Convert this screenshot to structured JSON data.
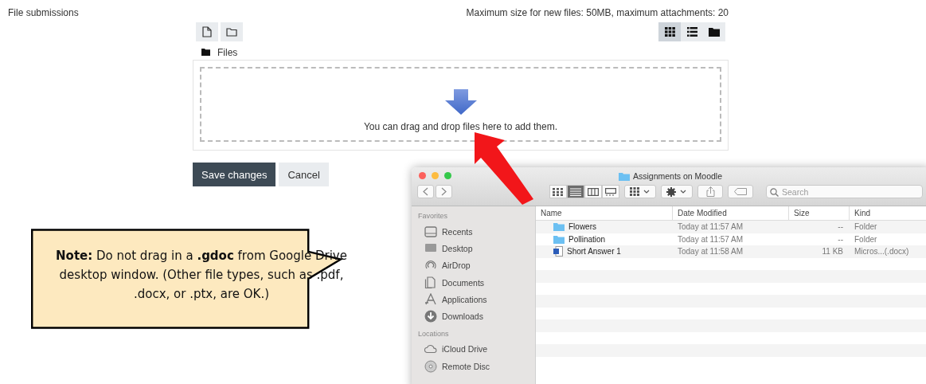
{
  "section_label": "File submissions",
  "limits": "Maximum size for new files: 50MB, maximum attachments: 20",
  "view_modes": [
    {
      "kind": "grid",
      "selected": true
    },
    {
      "kind": "list",
      "selected": false
    },
    {
      "kind": "tree",
      "selected": false
    }
  ],
  "breadcrumb": "Files",
  "dropzone_text": "You can drag and drop files here to add them.",
  "buttons": [
    {
      "label": "Save changes",
      "kind": "primary"
    },
    {
      "label": "Cancel",
      "kind": "secondary"
    }
  ],
  "callout": {
    "text": "**Note:** Do not drag in a **.gdoc** from Google Drive desktop window. (Other file types, such as .pdf, .docx, or .ptx, are OK.)"
  },
  "finder": {
    "title": "Assignments on Moodle",
    "view_modes": [
      {
        "kind": "icons",
        "selected": false
      },
      {
        "kind": "list",
        "selected": true
      },
      {
        "kind": "columns",
        "selected": false
      },
      {
        "kind": "gallery",
        "selected": false
      }
    ],
    "search": {
      "placeholder": "Search"
    },
    "sidebar": [
      {
        "heading": "Favorites",
        "items": [
          {
            "label": "Recents",
            "kind": "recents"
          },
          {
            "label": "Desktop",
            "kind": "desktop"
          },
          {
            "label": "AirDrop",
            "kind": "airdrop"
          },
          {
            "label": "Documents",
            "kind": "documents"
          },
          {
            "label": "Applications",
            "kind": "applications"
          },
          {
            "label": "Downloads",
            "kind": "downloads"
          }
        ]
      },
      {
        "heading": "Locations",
        "items": [
          {
            "label": "iCloud Drive",
            "kind": "cloud"
          },
          {
            "label": "Remote Disc",
            "kind": "disc"
          }
        ]
      }
    ],
    "columns": [
      "Name",
      "Date Modified",
      "Size",
      "Kind"
    ],
    "rows": [
      {
        "kind": "folder",
        "name": "Flowers",
        "date": "Today at 11:57 AM",
        "size": "--",
        "type": "Folder"
      },
      {
        "kind": "folder",
        "name": "Pollination",
        "date": "Today at 11:57 AM",
        "size": "--",
        "type": "Folder"
      },
      {
        "kind": "document",
        "name": "Short Answer 1",
        "date": "Today at 11:58 AM",
        "size": "11 KB",
        "type": "Micros...(.docx)"
      }
    ]
  }
}
